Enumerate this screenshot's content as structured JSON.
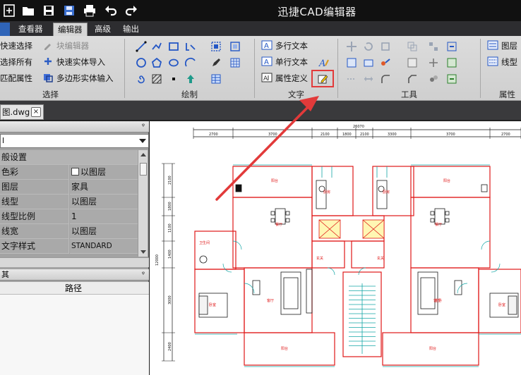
{
  "window": {
    "title": "迅捷CAD编辑器"
  },
  "quick_access": {
    "icons": [
      "new-icon",
      "open-icon",
      "save-icon",
      "save-as-icon",
      "print-icon",
      "undo-icon",
      "redo-icon"
    ]
  },
  "tabs": [
    {
      "label": "查看器"
    },
    {
      "label": "编辑器"
    },
    {
      "label": "高级"
    },
    {
      "label": "输出"
    }
  ],
  "ribbon": {
    "select": {
      "label": "选择",
      "items": [
        "快速选择",
        "选择所有",
        "匹配属性"
      ],
      "items2": [
        "块编辑器",
        "快速实体导入",
        "多边形实体输入"
      ]
    },
    "draw": {
      "label": "绘制"
    },
    "text": {
      "label": "文字",
      "items": [
        "多行文本",
        "单行文本",
        "属性定义"
      ]
    },
    "tools": {
      "label": "工具"
    },
    "props": {
      "label": "属性",
      "items": [
        "图层",
        "线型"
      ]
    }
  },
  "document": {
    "tab_label": "图.dwg",
    "close": "×"
  },
  "property_panel": {
    "combo_value": "l",
    "section_label": "般设置",
    "rows": [
      {
        "name": "色彩",
        "value": "以图层",
        "checkbox": true
      },
      {
        "name": "图层",
        "value": "家具"
      },
      {
        "name": "线型",
        "value": "以图层"
      },
      {
        "name": "线型比例",
        "value": "1"
      },
      {
        "name": "线宽",
        "value": "以图层"
      },
      {
        "name": "文字样式",
        "value": "STANDARD"
      }
    ],
    "pin": "ᵠ"
  },
  "path_panel": {
    "title": "其",
    "column": "路径",
    "pin": "ᵠ"
  },
  "drawing": {
    "total_dimension": "26070",
    "top_dims": [
      "2700",
      "3700",
      "2100",
      "1800",
      "2100",
      "3300",
      "3700",
      "2700"
    ],
    "left_dims": [
      "2100",
      "1800",
      "1100",
      "1400",
      "3000",
      "2400"
    ],
    "side_dim": "12000",
    "room_labels": [
      "阳台",
      "厨房",
      "餐厅",
      "卫生间",
      "客厅",
      "卧室",
      "主卧",
      "玄关",
      "阳台",
      "厨房",
      "餐厅",
      "客厅",
      "卧室",
      "玄关",
      "阳台",
      "阳台"
    ],
    "colors": {
      "wall": "#e01818",
      "furniture": "#1a1a1a",
      "fixture": "#14a6a6",
      "dimension": "#111111",
      "hatch": "#f2d400"
    }
  },
  "annotation": {
    "color": "#e23a3a"
  }
}
